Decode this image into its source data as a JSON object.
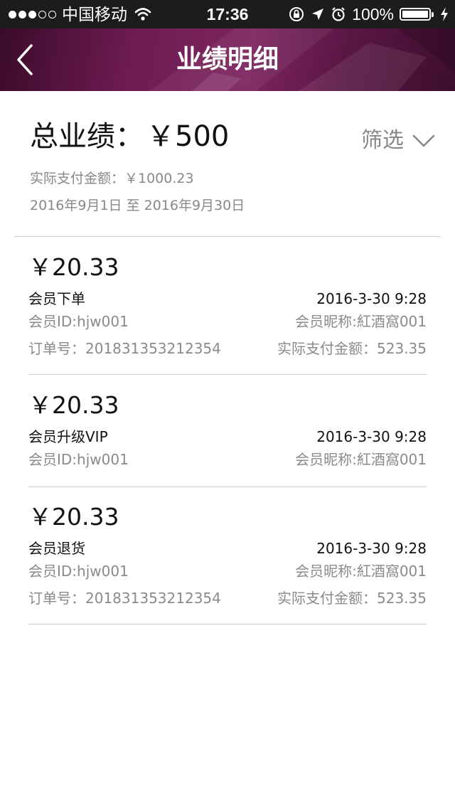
{
  "status_bar": {
    "carrier": "中国移动",
    "time": "17:36",
    "battery": "100%",
    "battery_level": 1.0,
    "icons": [
      "signal-dots",
      "wifi-icon",
      "orientation-lock-icon",
      "location-icon",
      "alarm-icon",
      "battery-icon",
      "charging-icon"
    ]
  },
  "nav": {
    "title": "业绩明细",
    "back_icon": "chevron-left-icon"
  },
  "summary": {
    "total_label": "总业绩：",
    "total_value": "￥500",
    "filter_label": "筛选",
    "paid_text": "实际支付金额：￥1000.23",
    "date_range": "2016年9月1日 至 2016年9月30日"
  },
  "records": [
    {
      "amount": "￥20.33",
      "type": "会员下单",
      "datetime": "2016-3-30  9:28",
      "member_id": "会员ID:hjw001",
      "nickname": "会员昵称:紅酒窩001",
      "order_no": "订单号：201831353212354",
      "paid": "实际支付金额：523.35"
    },
    {
      "amount": "￥20.33",
      "type": "会员升级VIP",
      "datetime": "2016-3-30  9:28",
      "member_id": "会员ID:hjw001",
      "nickname": "会员昵称:紅酒窩001"
    },
    {
      "amount": "￥20.33",
      "type": "会员退货",
      "datetime": "2016-3-30  9:28",
      "member_id": "会员ID:hjw001",
      "nickname": "会员昵称:紅酒窩001",
      "order_no": "订单号：201831353212354",
      "paid": "实际支付金额：523.35"
    }
  ],
  "colors": {
    "nav_bg": "#6f1c52",
    "status_bg": "#1c1c1c",
    "text_dark": "#111111",
    "text_gray": "#8a8a8a",
    "divider": "#c9c9c9"
  }
}
